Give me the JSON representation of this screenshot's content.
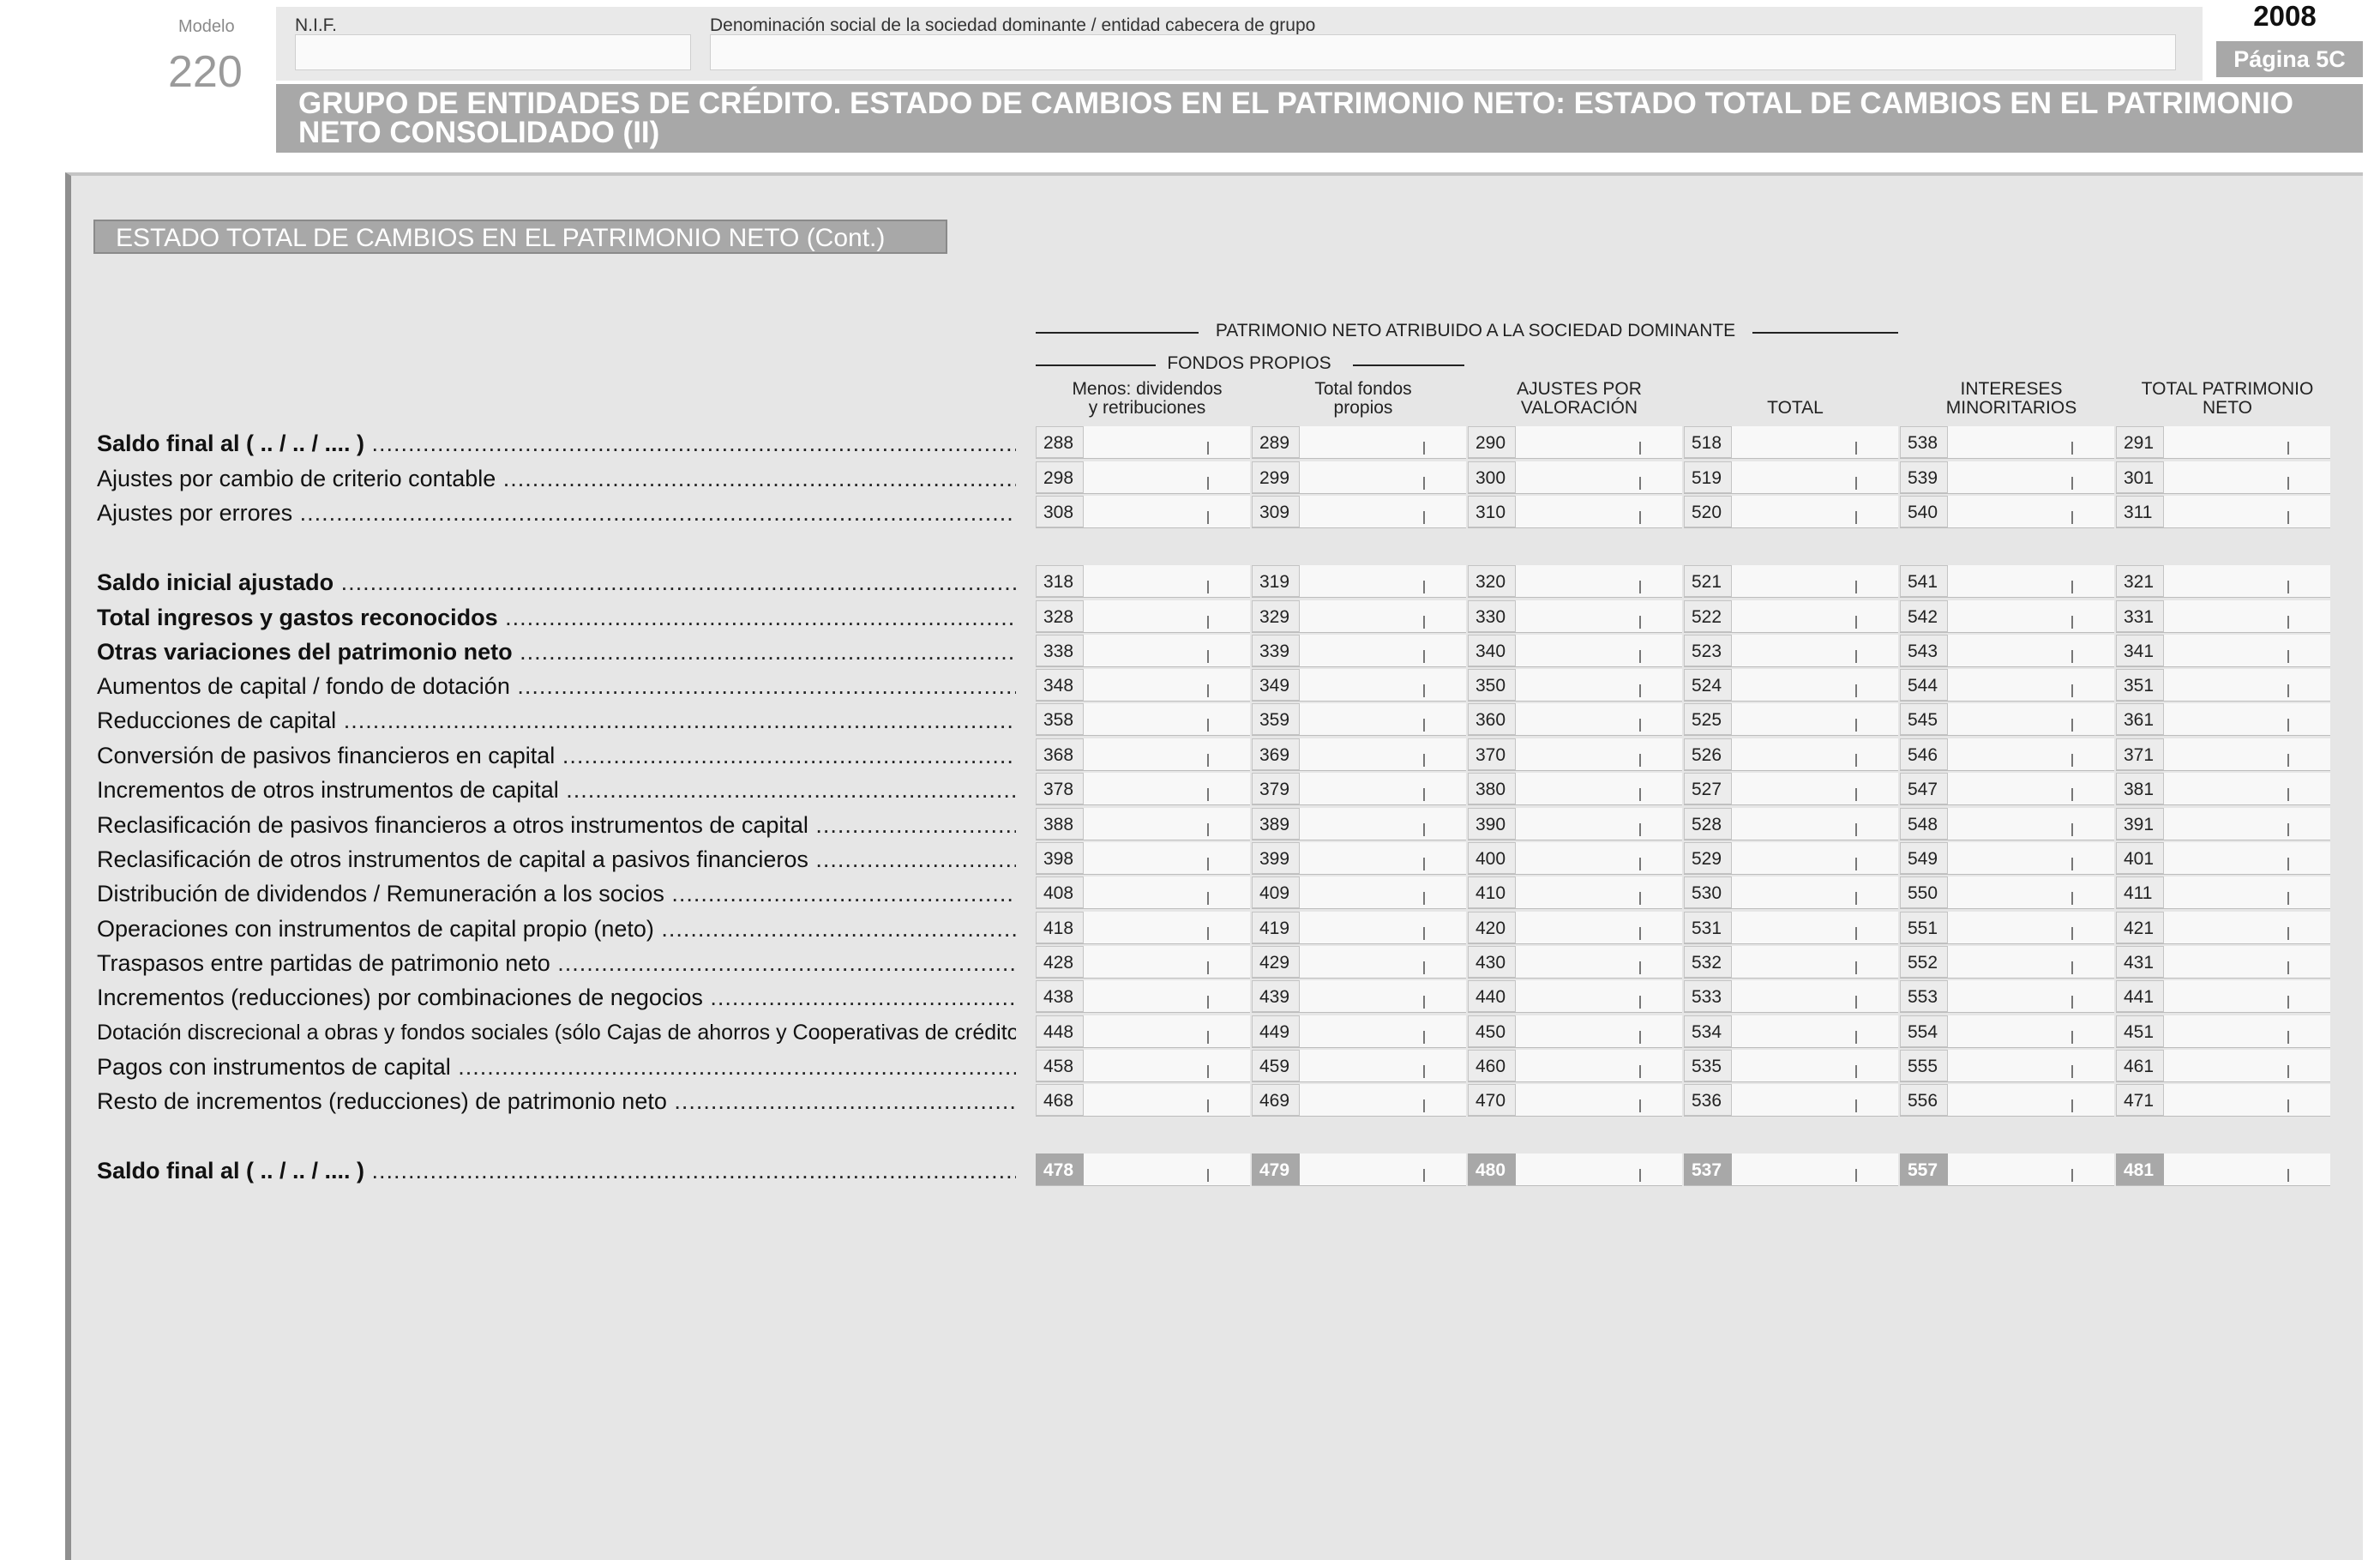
{
  "header": {
    "modelo_label": "Modelo",
    "modelo_number": "220",
    "nif_label": "N.I.F.",
    "nif_value": "",
    "denominacion_label": "Denominación social de la sociedad dominante / entidad cabecera de grupo",
    "denominacion_value": "",
    "year": "2008",
    "page": "Página 5C",
    "title": "GRUPO DE ENTIDADES DE CRÉDITO. ESTADO DE CAMBIOS EN EL PATRIMONIO NETO: ESTADO TOTAL DE CAMBIOS EN EL PATRIMONIO NETO CONSOLIDADO (II)"
  },
  "section_title": "ESTADO TOTAL DE CAMBIOS EN EL PATRIMONIO NETO (Cont.)",
  "column_groups": {
    "patrimonio_neto": "PATRIMONIO NETO ATRIBUIDO A LA SOCIEDAD DOMINANTE",
    "fondos_propios": "FONDOS PROPIOS"
  },
  "columns": [
    {
      "line1": "Menos: dividendos",
      "line2": "y retribuciones"
    },
    {
      "line1": "Total fondos",
      "line2": "propios"
    },
    {
      "line1": "AJUSTES POR",
      "line2": "VALORACIÓN"
    },
    {
      "line1": "",
      "line2": "TOTAL"
    },
    {
      "line1": "INTERESES",
      "line2": "MINORITARIOS"
    },
    {
      "line1": "TOTAL PATRIMONIO",
      "line2": "NETO"
    }
  ],
  "rows": [
    {
      "label": "Saldo final al ( .. / .. / .... )",
      "bold": true,
      "codes": [
        "288",
        "289",
        "290",
        "518",
        "538",
        "291"
      ]
    },
    {
      "label": "Ajustes por cambio de criterio contable",
      "bold": false,
      "codes": [
        "298",
        "299",
        "300",
        "519",
        "539",
        "301"
      ]
    },
    {
      "label": "Ajustes por errores",
      "bold": false,
      "codes": [
        "308",
        "309",
        "310",
        "520",
        "540",
        "311"
      ]
    },
    {
      "label": "Saldo inicial ajustado",
      "bold": true,
      "codes": [
        "318",
        "319",
        "320",
        "521",
        "541",
        "321"
      ]
    },
    {
      "label": "Total ingresos y gastos reconocidos",
      "bold": true,
      "codes": [
        "328",
        "329",
        "330",
        "522",
        "542",
        "331"
      ]
    },
    {
      "label": "Otras variaciones del patrimonio neto",
      "bold": true,
      "codes": [
        "338",
        "339",
        "340",
        "523",
        "543",
        "341"
      ]
    },
    {
      "label": "Aumentos de capital / fondo de dotación",
      "bold": false,
      "codes": [
        "348",
        "349",
        "350",
        "524",
        "544",
        "351"
      ]
    },
    {
      "label": "Reducciones de capital",
      "bold": false,
      "codes": [
        "358",
        "359",
        "360",
        "525",
        "545",
        "361"
      ]
    },
    {
      "label": "Conversión de pasivos financieros en capital",
      "bold": false,
      "codes": [
        "368",
        "369",
        "370",
        "526",
        "546",
        "371"
      ]
    },
    {
      "label": "Incrementos de otros instrumentos de capital",
      "bold": false,
      "codes": [
        "378",
        "379",
        "380",
        "527",
        "547",
        "381"
      ]
    },
    {
      "label": "Reclasificación de pasivos financieros a otros instrumentos de capital",
      "bold": false,
      "codes": [
        "388",
        "389",
        "390",
        "528",
        "548",
        "391"
      ]
    },
    {
      "label": "Reclasificación de otros instrumentos de capital a pasivos financieros",
      "bold": false,
      "codes": [
        "398",
        "399",
        "400",
        "529",
        "549",
        "401"
      ]
    },
    {
      "label": "Distribución de dividendos / Remuneración a los socios",
      "bold": false,
      "codes": [
        "408",
        "409",
        "410",
        "530",
        "550",
        "411"
      ]
    },
    {
      "label": "Operaciones con instrumentos de capital propio (neto)",
      "bold": false,
      "codes": [
        "418",
        "419",
        "420",
        "531",
        "551",
        "421"
      ]
    },
    {
      "label": "Traspasos entre partidas de patrimonio neto",
      "bold": false,
      "codes": [
        "428",
        "429",
        "430",
        "532",
        "552",
        "431"
      ]
    },
    {
      "label": "Incrementos (reducciones) por combinaciones de negocios",
      "bold": false,
      "codes": [
        "438",
        "439",
        "440",
        "533",
        "553",
        "441"
      ]
    },
    {
      "label": "Dotación discrecional a obras y fondos sociales (sólo Cajas de ahorros y Cooperativas de crédito)",
      "bold": false,
      "codes": [
        "448",
        "449",
        "450",
        "534",
        "554",
        "451"
      ]
    },
    {
      "label": "Pagos con instrumentos de capital",
      "bold": false,
      "codes": [
        "458",
        "459",
        "460",
        "535",
        "555",
        "461"
      ]
    },
    {
      "label": "Resto de incrementos (reducciones) de patrimonio neto",
      "bold": false,
      "codes": [
        "468",
        "469",
        "470",
        "536",
        "556",
        "471"
      ]
    },
    {
      "label": "Saldo final al ( .. / .. / .... )",
      "bold": true,
      "codes": [
        "478",
        "479",
        "480",
        "537",
        "557",
        "481"
      ]
    }
  ],
  "colors": {
    "header_bar": "#a8a8a8",
    "panel": "#e6e6e6",
    "cell": "#f8f8f8"
  }
}
